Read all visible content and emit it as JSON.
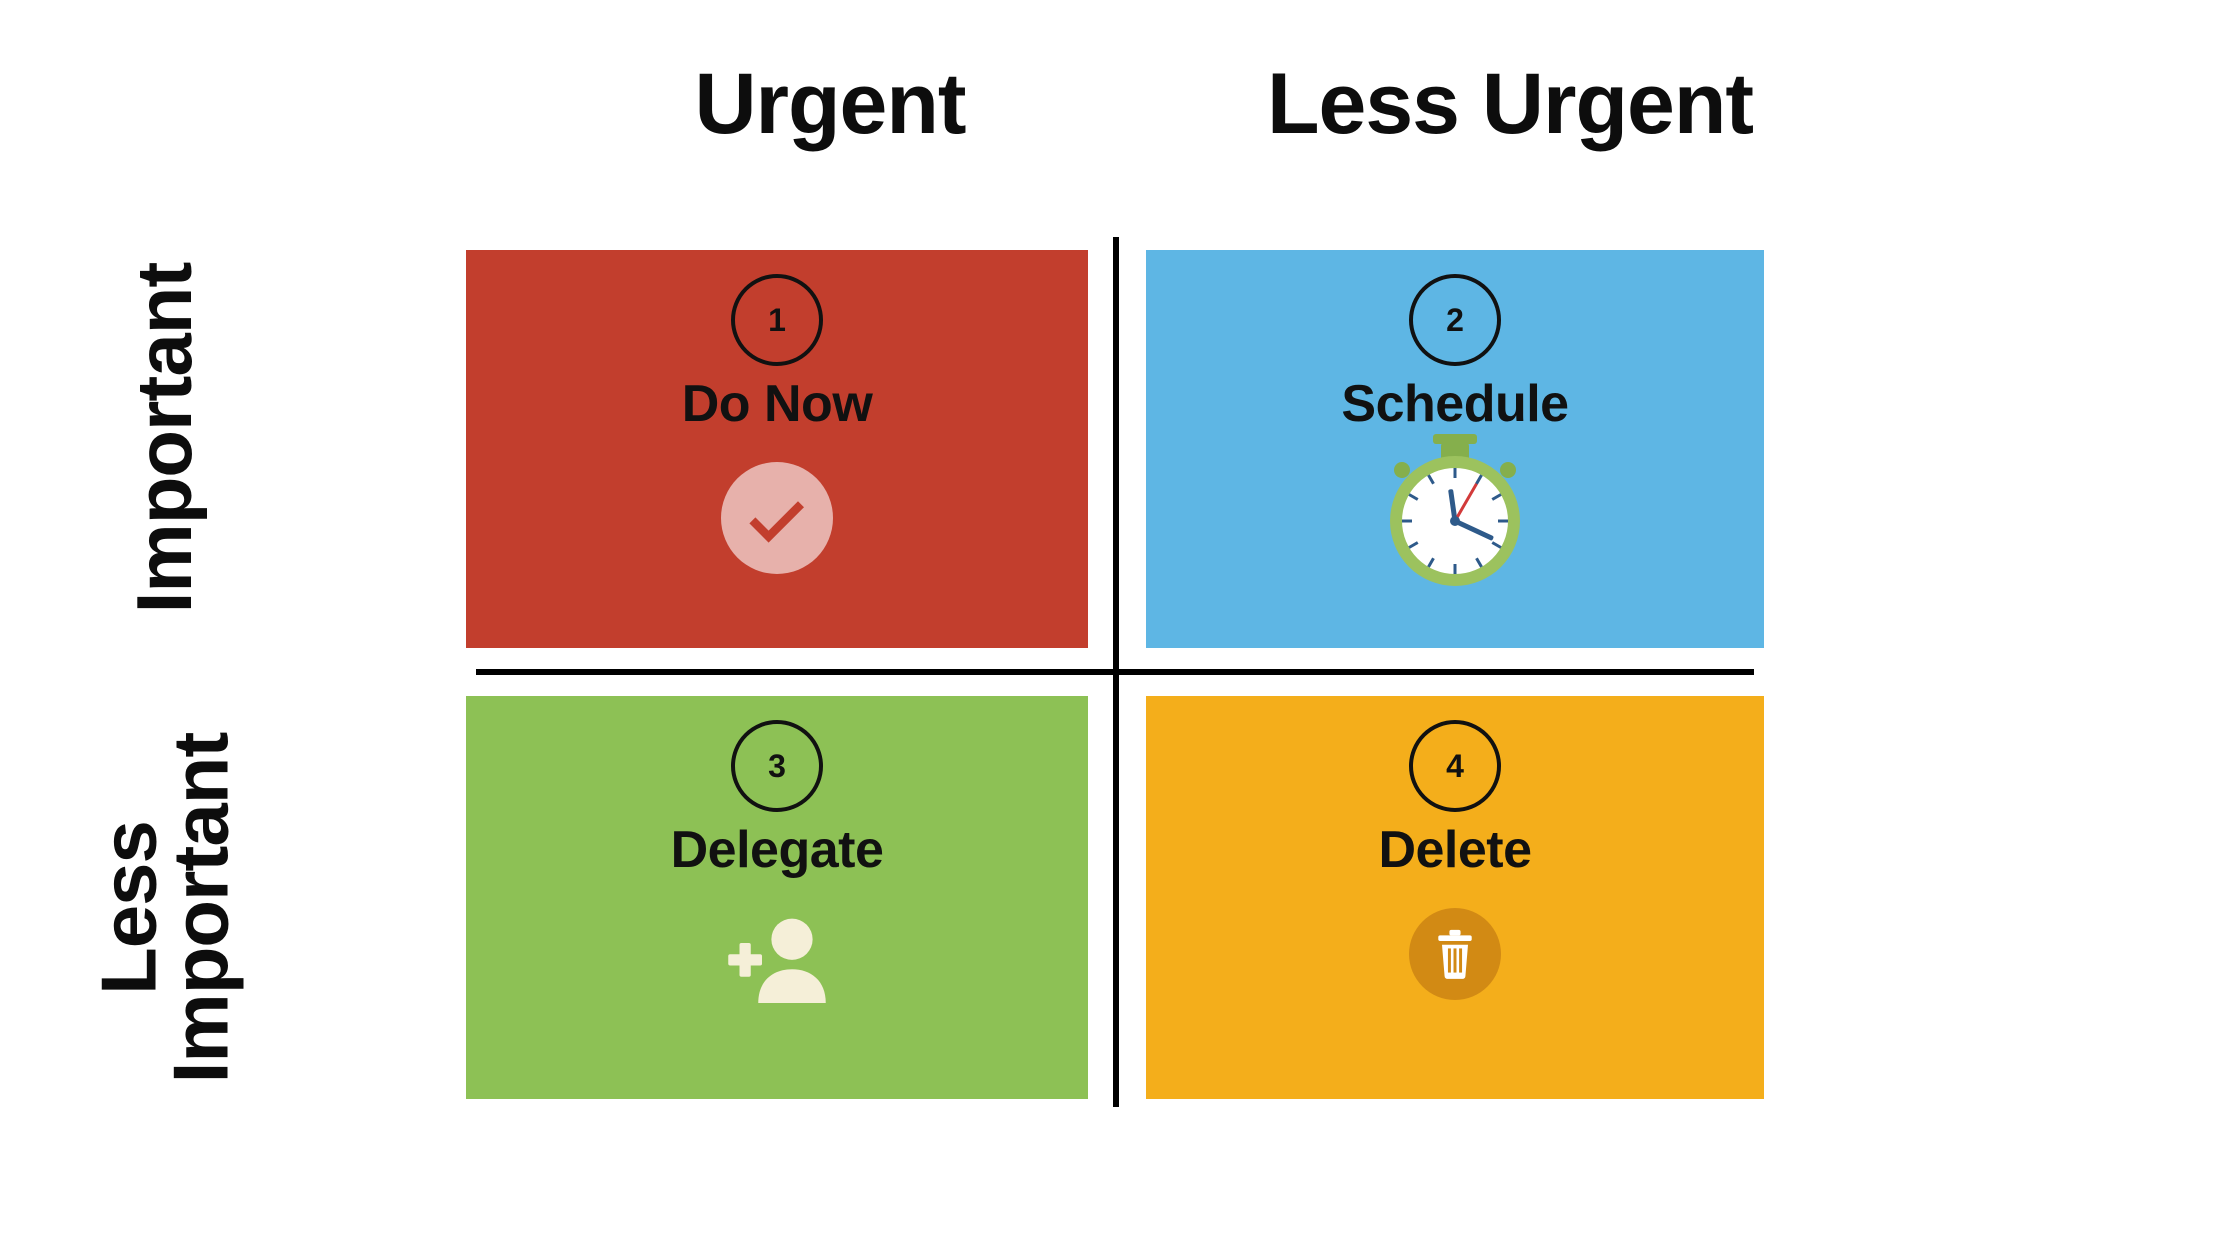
{
  "columns": {
    "urgent": "Urgent",
    "less_urgent": "Less Urgent"
  },
  "rows": {
    "important": "Important",
    "less_important": "Less\nImportant"
  },
  "quadrants": [
    {
      "n": "1",
      "title": "Do Now",
      "icon": "check",
      "color": "#c23e2d"
    },
    {
      "n": "2",
      "title": "Schedule",
      "icon": "stopwatch",
      "color": "#5eb6e4"
    },
    {
      "n": "3",
      "title": "Delegate",
      "icon": "add-user",
      "color": "#8dc155"
    },
    {
      "n": "4",
      "title": "Delete",
      "icon": "trash",
      "color": "#f4ae1b"
    }
  ]
}
